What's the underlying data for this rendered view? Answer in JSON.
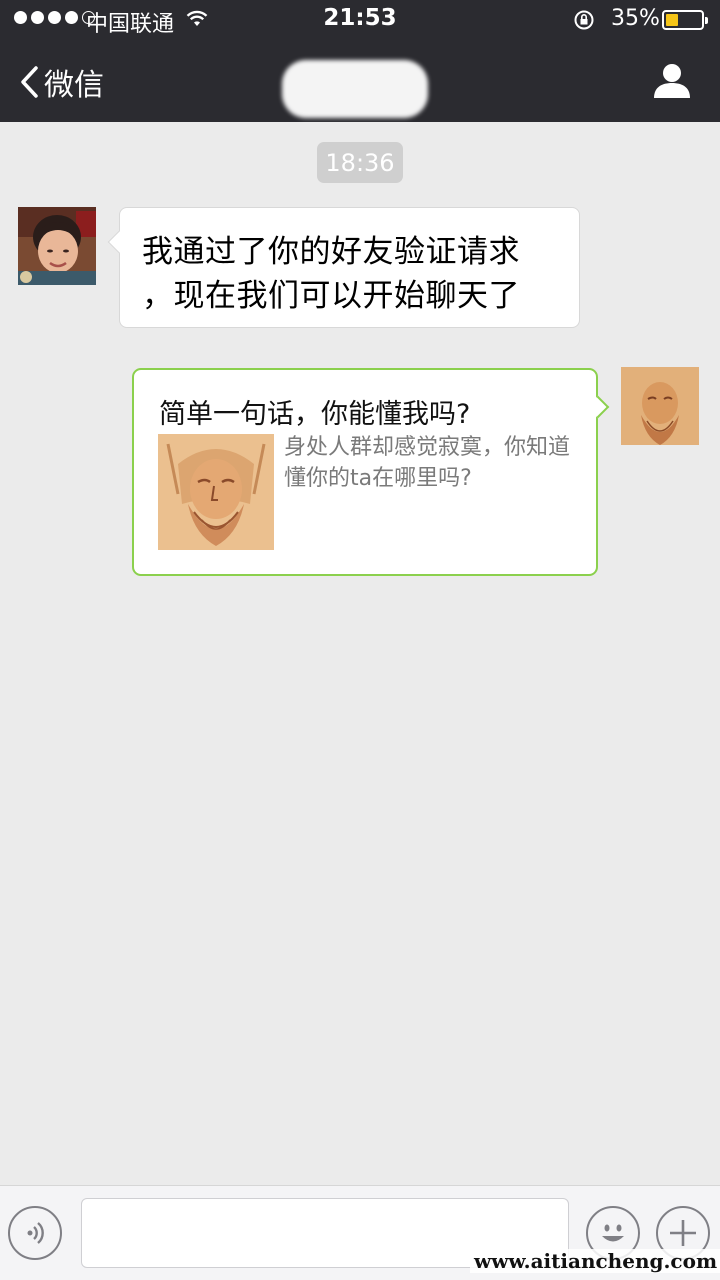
{
  "status_bar": {
    "carrier": "中国联通",
    "time": "21:53",
    "battery_percent_label": "35%",
    "battery_level": 0.35,
    "battery_color": "#f5c518",
    "signal_bars_filled": 4,
    "signal_bars_total": 5
  },
  "nav": {
    "back_label": "微信",
    "back_icon": "chevron-left-icon",
    "profile_icon": "person-icon"
  },
  "chat": {
    "timestamp": "18:36",
    "messages": [
      {
        "side": "left",
        "text": "我通过了你的好友验证请求，现在我们可以开始聊天了",
        "lines": [
          "我通过了你的好友验证请求",
          "，现在我们可以开始聊天了"
        ]
      },
      {
        "side": "right",
        "type": "link",
        "title": "简单一句话，你能懂我吗?",
        "description": "身处人群却感觉寂寞，你知道懂你的ta在哪里吗?",
        "bubble_border_color": "#8bd04d"
      }
    ]
  },
  "input_bar": {
    "voice_icon": "voice-icon",
    "emoji_icon": "emoji-icon",
    "plus_icon": "plus-icon",
    "text_value": ""
  },
  "watermark": "www.aitiancheng.com"
}
